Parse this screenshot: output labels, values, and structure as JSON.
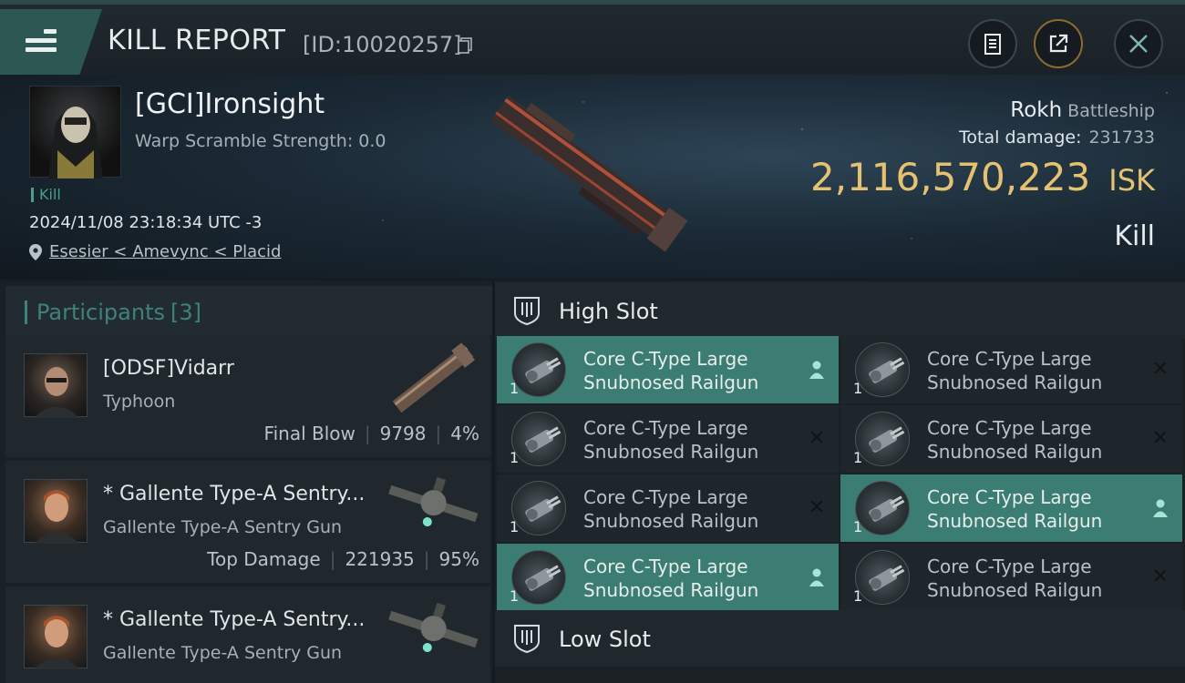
{
  "header": {
    "title": "KILL REPORT",
    "report_id": "[ID:10020257]",
    "icons": [
      "menu-icon",
      "copy-icon",
      "clipboard-icon",
      "share-icon",
      "close-icon"
    ]
  },
  "victim": {
    "name": "[GCI]Ironsight",
    "warp_scramble": "Warp Scramble Strength: 0.0",
    "tag": "Kill",
    "datetime": "2024/11/08 23:18:34 UTC -3",
    "location": "Esesier < Amevync < Placid",
    "ship_name": "Rokh",
    "ship_class": "Battleship",
    "total_damage_label": "Total damage:",
    "total_damage": "231733",
    "isk_value": "2,116,570,223",
    "isk_unit": "ISK",
    "result": "Kill"
  },
  "participants": {
    "title": "Participants",
    "count": "[3]",
    "rows": [
      {
        "name": "[ODSF]Vidarr",
        "ship": "Typhoon",
        "stat_label": "Final Blow",
        "damage": "9798",
        "percent": "4%"
      },
      {
        "name": "* Gallente Type-A Sentry...",
        "ship": "Gallente Type-A Sentry Gun",
        "stat_label": "Top Damage",
        "damage": "221935",
        "percent": "95%"
      },
      {
        "name": "* Gallente Type-A Sentry...",
        "ship": "Gallente Type-A Sentry Gun",
        "stat_label": "",
        "damage": "",
        "percent": ""
      }
    ]
  },
  "slots": {
    "high_slot_label": "High Slot",
    "low_slot_label": "Low Slot",
    "high_modules": [
      {
        "line1": "Core C-Type Large",
        "line2": "Snubnosed Railgun",
        "qty": "1",
        "status": "dropped"
      },
      {
        "line1": "Core C-Type Large",
        "line2": "Snubnosed Railgun",
        "qty": "1",
        "status": "destroyed"
      },
      {
        "line1": "Core C-Type Large",
        "line2": "Snubnosed Railgun",
        "qty": "1",
        "status": "destroyed"
      },
      {
        "line1": "Core C-Type Large",
        "line2": "Snubnosed Railgun",
        "qty": "1",
        "status": "destroyed"
      },
      {
        "line1": "Core C-Type Large",
        "line2": "Snubnosed Railgun",
        "qty": "1",
        "status": "destroyed"
      },
      {
        "line1": "Core C-Type Large",
        "line2": "Snubnosed Railgun",
        "qty": "1",
        "status": "dropped"
      },
      {
        "line1": "Core C-Type Large",
        "line2": "Snubnosed Railgun",
        "qty": "1",
        "status": "dropped"
      },
      {
        "line1": "Core C-Type Large",
        "line2": "Snubnosed Railgun",
        "qty": "1",
        "status": "destroyed"
      }
    ]
  },
  "colors": {
    "accent_teal": "#3c7d73",
    "isk_gold": "#e5c272",
    "panel": "#1f262b"
  }
}
